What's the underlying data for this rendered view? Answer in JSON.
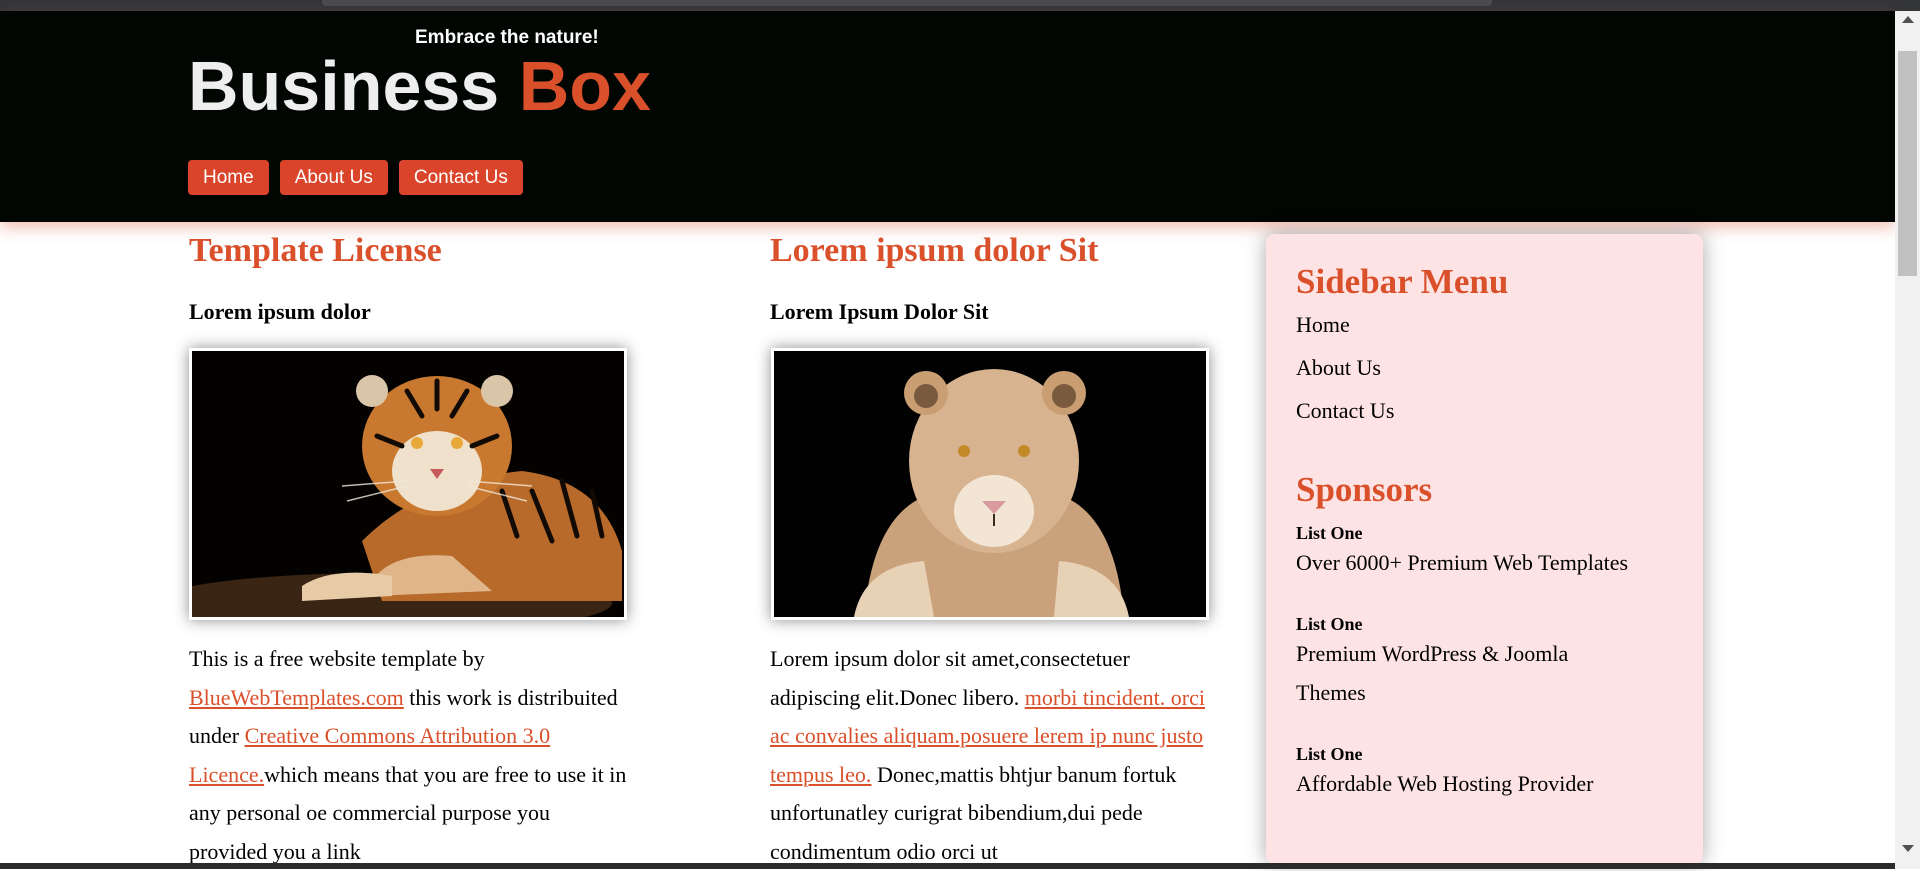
{
  "header": {
    "tagline": "Embrace the nature!",
    "logo_part1": "Business",
    "logo_part2": "Box",
    "nav": [
      {
        "label": "Home"
      },
      {
        "label": "About Us"
      },
      {
        "label": "Contact Us"
      }
    ]
  },
  "left_column": {
    "heading": "Template License",
    "subheading": "Lorem ipsum dolor",
    "image_subject": "tiger",
    "text_1": "This is a free website template by ",
    "link_1": "BlueWebTemplates.com",
    "text_2": " this work is distribuited under ",
    "link_2": "Creative Commons Attribution 3.0 Licence.",
    "text_3": "which means that you are free to use it in any personal oe commercial purpose you provided you a link"
  },
  "middle_column": {
    "heading": "Lorem ipsum dolor Sit",
    "subheading": "Lorem Ipsum Dolor Sit",
    "image_subject": "lioness",
    "text_1": "Lorem ipsum dolor sit amet,consectetuer adipiscing elit.Donec libero. ",
    "link_1": "morbi tincident. orci ac convalies aliquam.posuere lerem ip nunc justo tempus leo.",
    "text_2": " Donec,mattis bhtjur banum fortuk unfortunatley curigrat bibendium,dui pede condimentum odio orci ut"
  },
  "sidebar": {
    "menu_title": "Sidebar Menu",
    "menu_items": [
      "Home",
      "About Us",
      "Contact Us"
    ],
    "sponsors_title": "Sponsors",
    "sponsors": [
      {
        "title": "List One",
        "text": "Over 6000+ Premium Web Templates"
      },
      {
        "title": "List One",
        "text": "Premium WordPress & Joomla Themes"
      },
      {
        "title": "List One",
        "text": "Affordable Web Hosting Provider"
      }
    ]
  },
  "colors": {
    "accent": "#d9502b",
    "header_bg": "#020603",
    "sidebar_bg": "#fde3e4",
    "nav_button": "#d9442a"
  }
}
